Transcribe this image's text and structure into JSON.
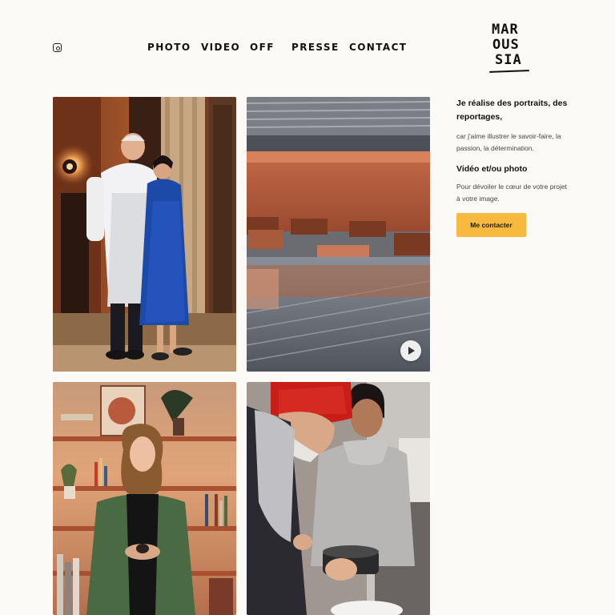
{
  "nav": {
    "items": [
      {
        "label": "PHOTO"
      },
      {
        "label": "VIDEO"
      },
      {
        "label": "OFF"
      },
      {
        "label": "PRESSE"
      },
      {
        "label": "CONTACT"
      }
    ]
  },
  "logo": {
    "line1": "MAR",
    "line2": "OUS",
    "line3": "SIA"
  },
  "social": {
    "icon": "instagram-icon"
  },
  "intro": {
    "heading": "Je réalise des portraits, des reportages,",
    "text1": "car j'aime illustrer le savoir-faire, la passion, la détermination.",
    "subheading": "Vidéo et/ou photo",
    "text2": "Pour dévoiler le cœur de votre projet à votre image.",
    "cta_label": "Me contacter"
  },
  "gallery": {
    "items": [
      {
        "subject": "chef-and-woman-portrait"
      },
      {
        "subject": "chocolate-production-video",
        "icon": "play-icon"
      },
      {
        "subject": "man-bookshelf-portrait"
      },
      {
        "subject": "kitchen-reportage"
      }
    ]
  },
  "colors": {
    "background": "#fcfaf7",
    "accent": "#f7b93e",
    "text": "#111111"
  }
}
